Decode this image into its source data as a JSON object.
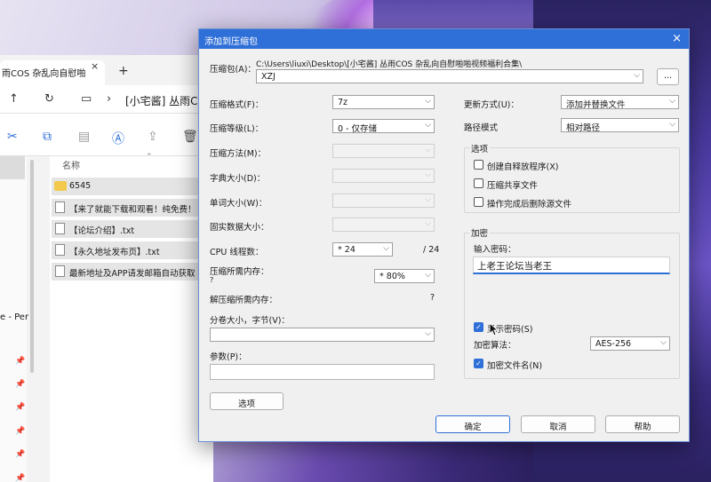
{
  "explorer": {
    "tab_title": "雨COS 杂乱向自慰啪",
    "tab_close": "×",
    "new_tab": "+",
    "path": "[小宅酱] 丛雨CO",
    "nav_text": "e - Per",
    "column_name": "名称",
    "files": [
      {
        "name": "6545",
        "type": "folder"
      },
      {
        "name": "【来了就能下载和观看！纯免费！",
        "type": "txt"
      },
      {
        "name": "【论坛介绍】.txt",
        "type": "txt"
      },
      {
        "name": "【永久地址发布页】.txt",
        "type": "txt"
      },
      {
        "name": "最新地址及APP请发邮箱自动获取",
        "type": "txt"
      }
    ],
    "icons": [
      "up-arrow-icon",
      "refresh-icon",
      "monitor-icon",
      "chevron-right-icon",
      "cut-icon",
      "copy-icon",
      "paste-icon",
      "rename-icon",
      "share-icon",
      "delete-icon",
      "pin-icon"
    ]
  },
  "dialog": {
    "title": "添加到压缩包",
    "close": "×",
    "archive_label": "压缩包(A)：",
    "archive_path": "C:\\Users\\liuxi\\Desktop\\[小宅酱] 丛雨COS 杂乱向自慰啪啪视频福利合集\\",
    "archive_name": "XZJ",
    "browse_label": "...",
    "format_label": "压缩格式(F)：",
    "format_value": "7z",
    "level_label": "压缩等级(L)：",
    "level_value": "0 - 仅存储",
    "method_label": "压缩方法(M)：",
    "dict_label": "字典大小(D)：",
    "word_label": "单词大小(W)：",
    "solid_label": "固实数据大小：",
    "cpu_label": "CPU 线程数：",
    "cpu_value": "* 24",
    "cpu_total": "/ 24",
    "mem_label": "压缩所需内存：",
    "mem_q": "?",
    "mem_value": "* 80%",
    "decomp_label": "解压缩所需内存：",
    "decomp_q": "?",
    "split_label": "分卷大小，字节(V)：",
    "params_label": "参数(P)：",
    "options_button": "选项",
    "update_label": "更新方式(U)：",
    "update_value": "添加并替换文件",
    "pathmode_label": "路径模式",
    "pathmode_value": "相对路径",
    "options_group": "选项",
    "opt_sfx": "创建自释放程序(X)",
    "opt_shared": "压缩共享文件",
    "opt_delete": "操作完成后删除源文件",
    "encrypt_group": "加密",
    "password_label": "输入密码：",
    "password_value": "上老王论坛当老王",
    "show_password": "显示密码(S)",
    "enc_method_label": "加密算法：",
    "enc_method_value": "AES-256",
    "encrypt_names": "加密文件名(N)",
    "ok": "确定",
    "cancel": "取消",
    "help": "帮助",
    "accent": "#2f6fd8"
  }
}
